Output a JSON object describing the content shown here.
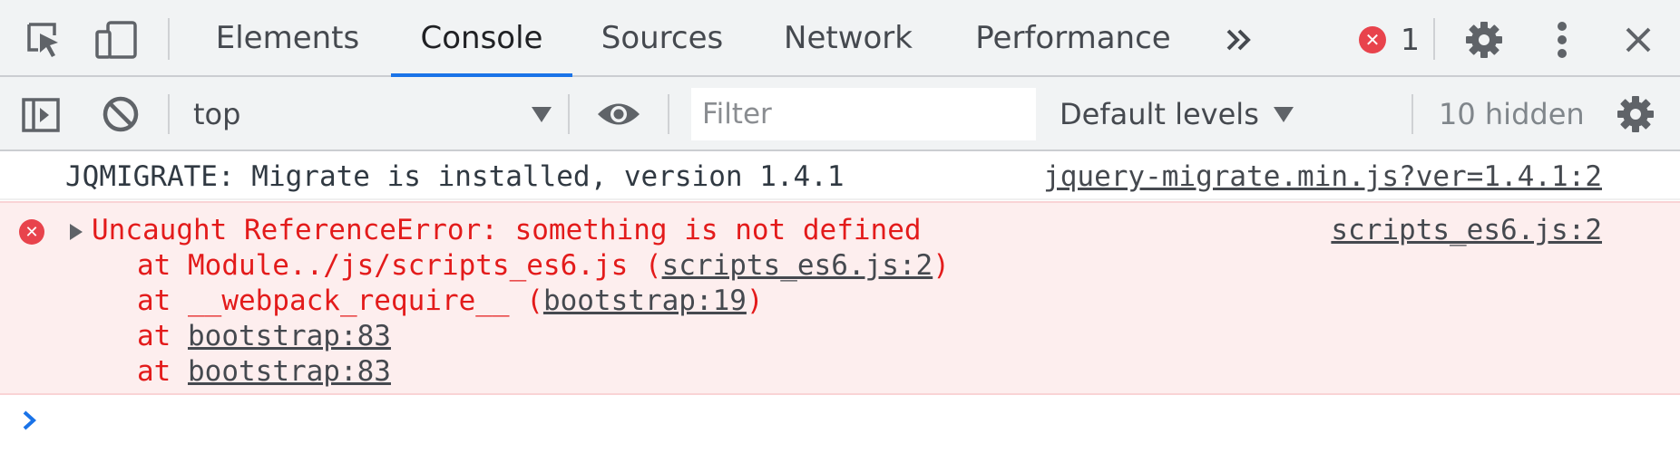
{
  "tabs": [
    {
      "label": "Elements"
    },
    {
      "label": "Console",
      "active": true
    },
    {
      "label": "Sources"
    },
    {
      "label": "Network"
    },
    {
      "label": "Performance"
    }
  ],
  "tabbar": {
    "more_tabs_icon": "double-chevron-right-icon",
    "error_count": "1",
    "settings_icon": "gear-icon",
    "menu_icon": "kebab-menu-icon",
    "close_icon": "close-icon",
    "active_accent": "#1a73e8",
    "error_color": "#e8434c"
  },
  "toolbar": {
    "sidebar_icon": "show-sidebar-icon",
    "clear_icon": "clear-console-icon",
    "context": "top",
    "eye_icon": "eye-icon",
    "filter_placeholder": "Filter",
    "filter_value": "",
    "levels_label": "Default levels",
    "hidden_label": "10 hidden",
    "settings_icon": "gear-icon"
  },
  "messages": {
    "log": {
      "text": "JQMIGRATE: Migrate is installed, version 1.4.1",
      "source": "jquery-migrate.min.js?ver=1.4.1:2"
    },
    "error": {
      "title": "Uncaught ReferenceError: something is not defined",
      "source": "scripts_es6.js:2",
      "stack": [
        {
          "prefix": "at Module../js/scripts_es6.js (",
          "link": "scripts_es6.js:2",
          "suffix": ")"
        },
        {
          "prefix": "at __webpack_require__ (",
          "link": "bootstrap:19",
          "suffix": ")"
        },
        {
          "prefix": "at ",
          "link": "bootstrap:83",
          "suffix": ""
        },
        {
          "prefix": "at ",
          "link": "bootstrap:83",
          "suffix": ""
        }
      ]
    }
  },
  "prompt_icon": "prompt-chevron-icon"
}
